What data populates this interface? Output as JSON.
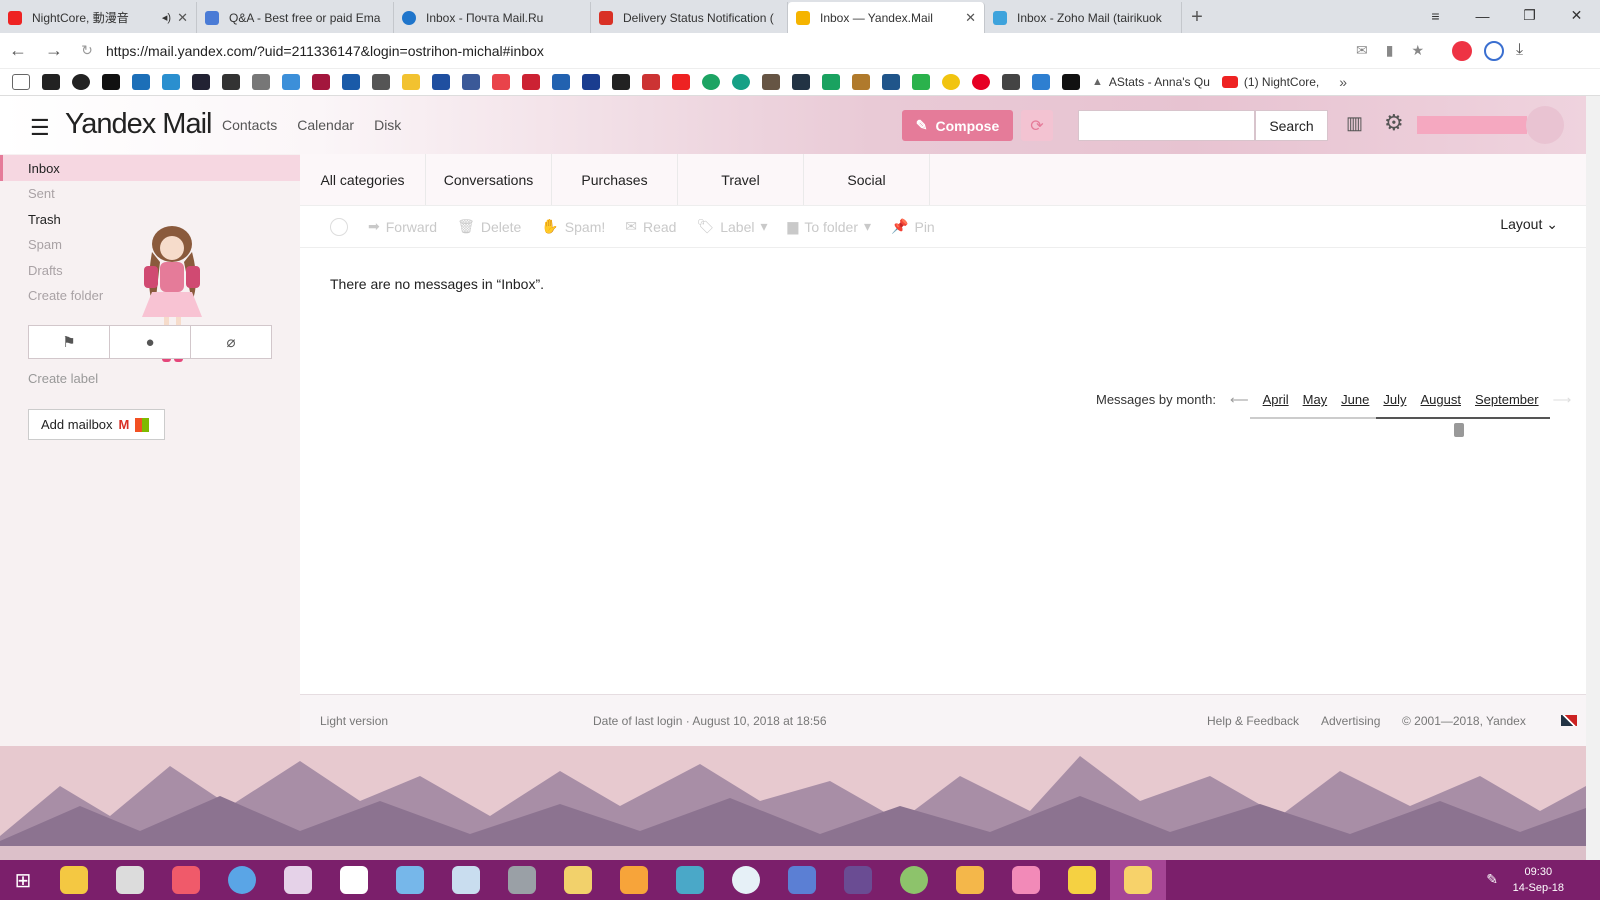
{
  "browser": {
    "tabs": [
      {
        "title": "NightCore, 動漫音",
        "color": "#e22",
        "active": false
      },
      {
        "title": "Q&A - Best free or paid Ema",
        "color": "#4a7bd6",
        "active": false
      },
      {
        "title": "Inbox - Почта Mail.Ru",
        "color": "#1f75cb",
        "active": false
      },
      {
        "title": "Delivery Status Notification (",
        "color": "#d93025",
        "active": false
      },
      {
        "title": "Inbox — Yandex.Mail",
        "color": "#f5b400",
        "active": true
      },
      {
        "title": "Inbox - Zoho Mail (tairikuok",
        "color": "#3ea3dc",
        "active": false
      }
    ],
    "url": "https://mail.yandex.com/?uid=211336147&login=ostrihon-michal#inbox",
    "bookmarks": [
      {
        "label": "AStats - Anna's Qu"
      },
      {
        "label": "(1)  NightCore,"
      }
    ]
  },
  "header": {
    "logo_main": "Yandex",
    "logo_sub": "Mail",
    "nav": [
      "Contacts",
      "Calendar",
      "Disk"
    ],
    "compose_label": "Compose",
    "search_placeholder": "",
    "search_label": "Search"
  },
  "sidebar": {
    "folders": [
      {
        "label": "Inbox",
        "state": "active"
      },
      {
        "label": "Sent",
        "state": "muted"
      },
      {
        "label": "Trash",
        "state": "dark"
      },
      {
        "label": "Spam",
        "state": "muted"
      },
      {
        "label": "Drafts",
        "state": "muted"
      },
      {
        "label": "Create folder",
        "state": "muted"
      }
    ],
    "create_label": "Create label",
    "add_mailbox": "Add mailbox"
  },
  "main": {
    "categories": [
      "All categories",
      "Conversations",
      "Purchases",
      "Travel",
      "Social"
    ],
    "toolbar": [
      "Forward",
      "Delete",
      "Spam!",
      "Read",
      "Label",
      "To folder",
      "Pin"
    ],
    "layout_label": "Layout",
    "empty_message": "There are no messages in “Inbox”.",
    "months_label": "Messages by month:",
    "months": [
      "April",
      "May",
      "June",
      "July",
      "August",
      "September"
    ]
  },
  "footer": {
    "light_version": "Light version",
    "last_login": "Date of last login · August 10, 2018 at 18:56",
    "help": "Help & Feedback",
    "advertising": "Advertising",
    "copyright": "© 2001—2018, Yandex"
  },
  "taskbar": {
    "time": "09:30",
    "date": "14-Sep-18"
  }
}
